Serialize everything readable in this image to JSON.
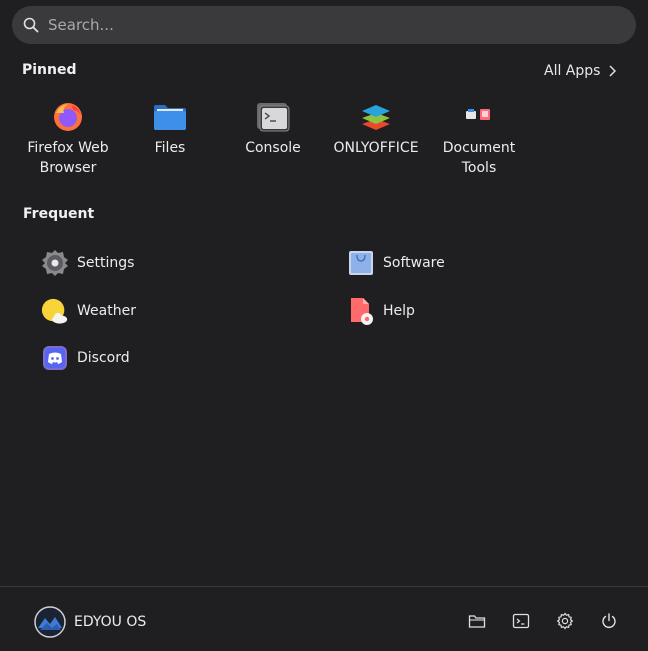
{
  "search": {
    "placeholder": "Search..."
  },
  "pinned": {
    "title": "Pinned",
    "all_apps": "All Apps",
    "items": [
      {
        "label": "Firefox Web Browser",
        "icon": "firefox-icon"
      },
      {
        "label": "Files",
        "icon": "folder-icon"
      },
      {
        "label": "Console",
        "icon": "terminal-icon"
      },
      {
        "label": "ONLYOFFICE",
        "icon": "onlyoffice-icon"
      },
      {
        "label": "Document Tools",
        "icon": "document-tools-icon"
      }
    ]
  },
  "frequent": {
    "title": "Frequent",
    "items": [
      {
        "label": "Settings",
        "icon": "gear-icon"
      },
      {
        "label": "Software",
        "icon": "software-bag-icon"
      },
      {
        "label": "Weather",
        "icon": "weather-sun-icon"
      },
      {
        "label": "Help",
        "icon": "help-icon"
      },
      {
        "label": "Discord",
        "icon": "discord-icon"
      }
    ]
  },
  "footer": {
    "user_label": "EDYOU OS",
    "buttons": [
      "folder-icon",
      "terminal-icon",
      "gear-icon",
      "power-icon"
    ]
  },
  "colors": {
    "background": "#1f1f21",
    "search_bg": "#3a3a3d",
    "firefox_orange": "#ff7139",
    "files_blue": "#3d8fe8",
    "help_red": "#ff6b6b",
    "weather_yellow": "#f8d33a",
    "discord_purple": "#5865f2"
  }
}
